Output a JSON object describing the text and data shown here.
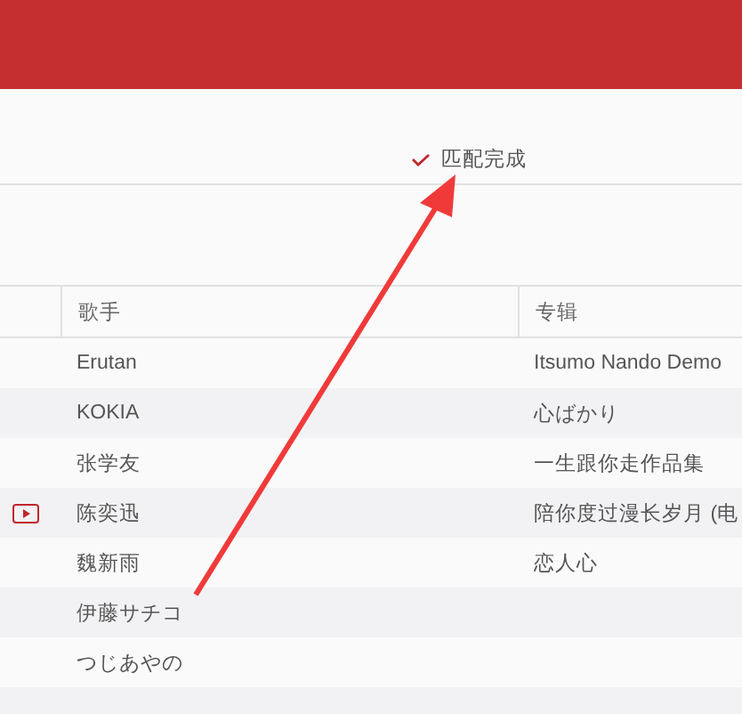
{
  "status": {
    "text": "匹配完成"
  },
  "table": {
    "columns": [
      "歌手",
      "专辑"
    ],
    "rows": [
      {
        "artist": "Erutan",
        "album": "Itsumo Nando Demo",
        "mv": false
      },
      {
        "artist": "KOKIA",
        "album": "心ばかり",
        "mv": false
      },
      {
        "artist": "张学友",
        "album": "一生跟你走作品集",
        "mv": false
      },
      {
        "artist": "陈奕迅",
        "album": "陪你度过漫长岁月 (电",
        "mv": true
      },
      {
        "artist": "魏新雨",
        "album": "恋人心",
        "mv": false
      },
      {
        "artist": "伊藤サチコ",
        "mv": false
      },
      {
        "artist": "つじあやの",
        "mv": false
      }
    ]
  }
}
